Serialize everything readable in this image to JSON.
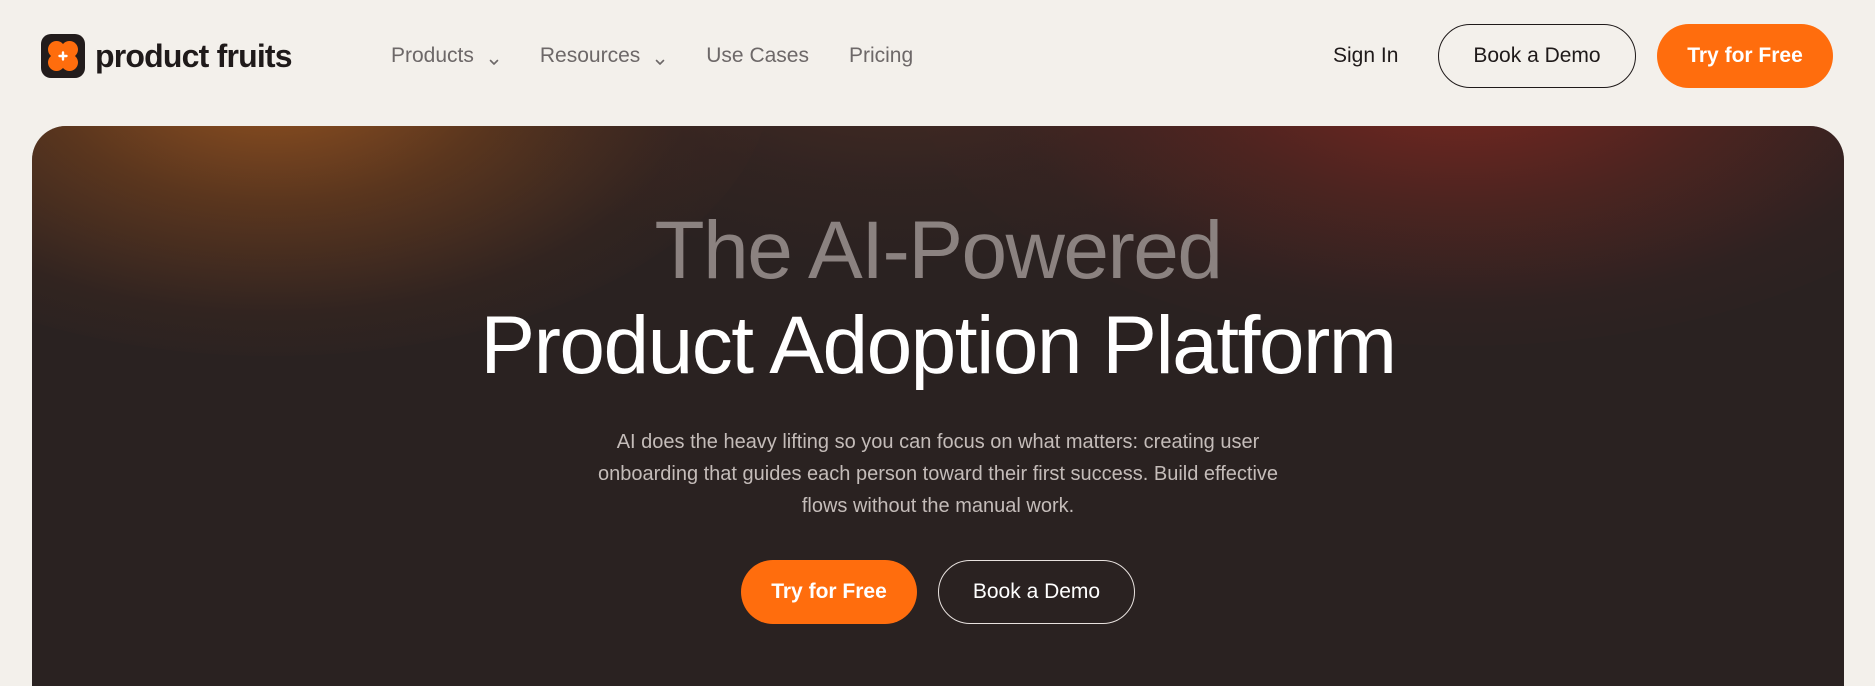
{
  "header": {
    "logo_text": "product fruits",
    "nav": [
      {
        "label": "Products",
        "has_dropdown": true
      },
      {
        "label": "Resources",
        "has_dropdown": true
      },
      {
        "label": "Use Cases",
        "has_dropdown": false
      },
      {
        "label": "Pricing",
        "has_dropdown": false
      }
    ],
    "sign_in_label": "Sign In",
    "book_demo_label": "Book a Demo",
    "try_free_label": "Try for Free"
  },
  "hero": {
    "title_line1": "The AI-Powered",
    "title_line2": "Product Adoption Platform",
    "subtitle": "AI does the heavy lifting so you can focus on what matters: creating user onboarding that guides each person toward their first success. Build effective flows without the manual work.",
    "primary_cta_label": "Try for Free",
    "secondary_cta_label": "Book a Demo"
  },
  "colors": {
    "accent": "#ff6d0d",
    "page_background": "#f3f0eb",
    "hero_background": "#2a2221",
    "text_dark": "#1f1a1a"
  },
  "icons": {
    "logo": "product-fruits-logo-icon",
    "dropdown": "chevron-down-icon"
  }
}
